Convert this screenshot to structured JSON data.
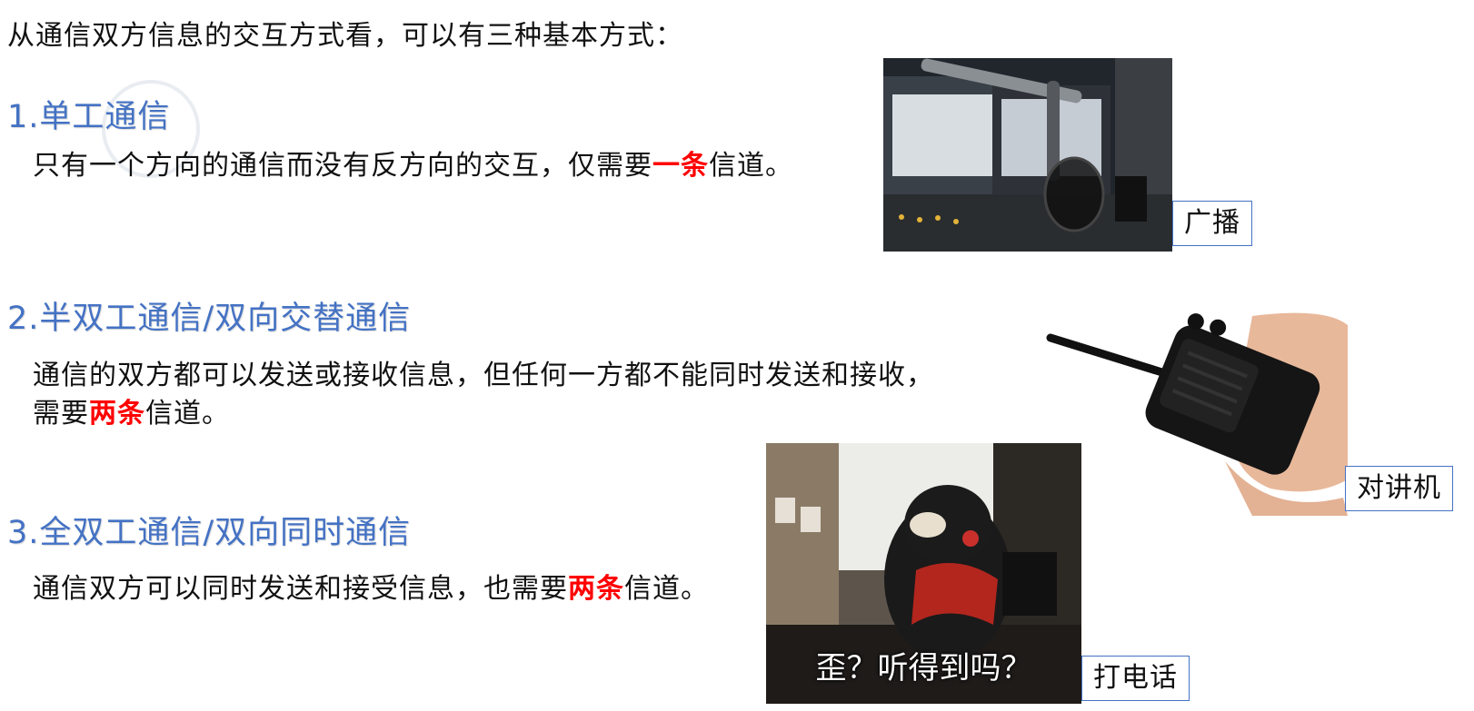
{
  "intro": "从通信双方信息的交互方式看，可以有三种基本方式：",
  "sections": [
    {
      "heading": "1.单工通信",
      "text_before": "只有一个方向的通信而没有反方向的交互，仅需要",
      "highlight": "一条",
      "text_after": "信道。",
      "caption": "广播",
      "image": "broadcast-microphone-photo"
    },
    {
      "heading": "2.半双工通信/双向交替通信",
      "text_line1": "通信的双方都可以发送或接收信息，但任何一方都不能同时发送和接收，",
      "text_before": "需要",
      "highlight": "两条",
      "text_after": "信道。",
      "caption": "对讲机",
      "image": "walkie-talkie-in-hand-photo"
    },
    {
      "heading": "3.全双工通信/双向同时通信",
      "text_before": "通信双方可以同时发送和接受信息，也需要",
      "highlight": "两条",
      "text_after": "信道。",
      "caption": "打电话",
      "image": "bear-on-phone-photo",
      "image_subtitle": "歪？听得到吗？"
    }
  ],
  "colors": {
    "heading": "#4472c4",
    "highlight": "#ff0000",
    "caption_border": "#4472c4"
  }
}
